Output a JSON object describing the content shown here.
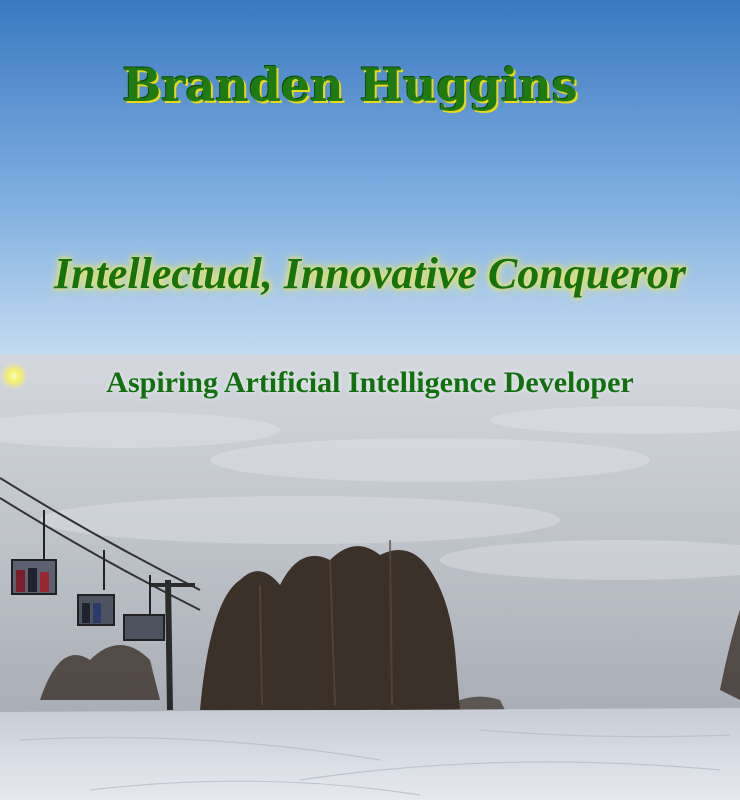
{
  "header": {
    "name": "Branden Huggins",
    "motto": "Intellectual, Innovative Conqueror",
    "tagline": "Aspiring Artificial Intelligence Developer"
  },
  "background": {
    "scene": "ski-slope-above-cloud-sea",
    "colors": {
      "sky_top": "#3f7fc4",
      "sky_horizon": "#b9d5ee",
      "cloud": "#c9ccd2",
      "snow": "#dfe3ea",
      "text_green": "#1a7512",
      "glow_yellow": "#f3e548"
    }
  }
}
